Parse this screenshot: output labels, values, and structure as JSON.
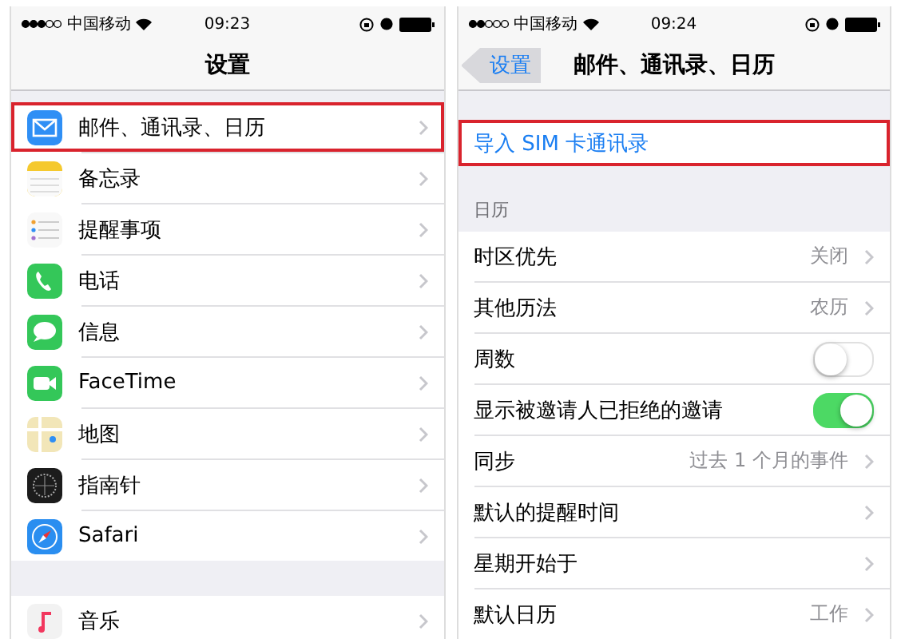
{
  "screens": [
    {
      "status": {
        "carrier": "中国移动",
        "time": "09:23"
      },
      "nav": {
        "title": "设置"
      },
      "groups": [
        {
          "items": [
            {
              "label": "邮件、通讯录、日历",
              "color": "#2f8ff5",
              "highlighted": true
            },
            {
              "label": "备忘录",
              "color": "#f5c92e",
              "highlighted": false
            },
            {
              "label": "提醒事项",
              "color": "#f8f8f8",
              "highlighted": false
            },
            {
              "label": "电话",
              "color": "#34c759",
              "highlighted": false
            },
            {
              "label": "信息",
              "color": "#34c759",
              "highlighted": false
            },
            {
              "label": "FaceTime",
              "color": "#34c759",
              "highlighted": false
            },
            {
              "label": "地图",
              "color": "#f2e6b8",
              "highlighted": false
            },
            {
              "label": "指南针",
              "color": "#1c1c1c",
              "highlighted": false
            },
            {
              "label": "Safari",
              "color": "#2a8ef0",
              "highlighted": false
            }
          ]
        },
        {
          "items": [
            {
              "label": "音乐",
              "color": "#f2f2f2",
              "highlighted": false
            }
          ]
        }
      ]
    },
    {
      "status": {
        "carrier": "中国移动",
        "time": "09:24"
      },
      "nav": {
        "back": "设置",
        "title": "邮件、通讯录、日历"
      },
      "action": {
        "label": "导入 SIM 卡通讯录",
        "highlighted": true
      },
      "section": {
        "header": "日历",
        "rows": [
          {
            "kind": "link",
            "label": "时区优先",
            "value": "关闭"
          },
          {
            "kind": "link",
            "label": "其他历法",
            "value": "农历"
          },
          {
            "kind": "toggle",
            "label": "周数",
            "on": false
          },
          {
            "kind": "toggle",
            "label": "显示被邀请人已拒绝的邀请",
            "on": true
          },
          {
            "kind": "link",
            "label": "同步",
            "value": "过去 1 个月的事件"
          },
          {
            "kind": "link",
            "label": "默认的提醒时间"
          },
          {
            "kind": "link",
            "label": "星期开始于"
          },
          {
            "kind": "link",
            "label": "默认日历",
            "value": "工作"
          }
        ]
      }
    }
  ]
}
